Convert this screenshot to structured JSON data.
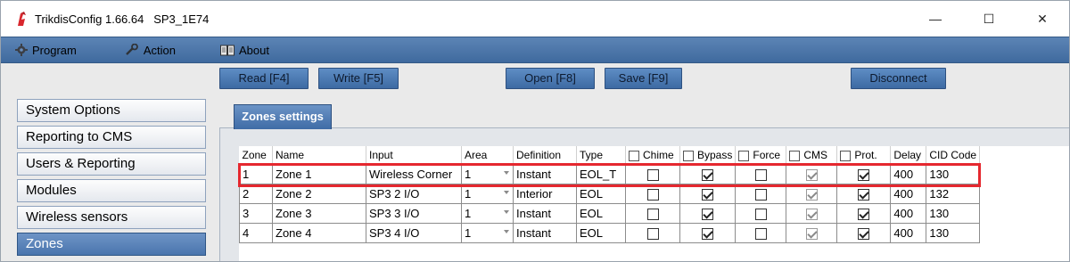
{
  "window": {
    "title": "TrikdisConfig 1.66.64   SP3_1E74",
    "minimize": "—",
    "maximize": "☐",
    "close": "✕"
  },
  "menu": {
    "program": "Program",
    "action": "Action",
    "about": "About"
  },
  "toolbar": {
    "read": "Read [F4]",
    "write": "Write [F5]",
    "open": "Open [F8]",
    "save": "Save [F9]",
    "disconnect": "Disconnect"
  },
  "sidebar": {
    "items": [
      {
        "label": "System Options"
      },
      {
        "label": "Reporting to CMS"
      },
      {
        "label": "Users & Reporting"
      },
      {
        "label": "Modules"
      },
      {
        "label": "Wireless sensors"
      },
      {
        "label": "Zones"
      }
    ],
    "active_index": 5
  },
  "tab": {
    "label": "Zones settings"
  },
  "table": {
    "headers": {
      "zone": "Zone",
      "name": "Name",
      "input": "Input",
      "area": "Area",
      "definition": "Definition",
      "type": "Type",
      "chime": "Chime",
      "bypass": "Bypass",
      "force": "Force",
      "cms": "CMS",
      "prot": "Prot.",
      "delay": "Delay",
      "cid": "CID Code"
    },
    "rows": [
      {
        "zone": "1",
        "name": "Zone 1",
        "input": "Wireless Corner",
        "area": "1",
        "definition": "Instant",
        "type": "EOL_T",
        "chime": false,
        "bypass": true,
        "force": false,
        "cms": true,
        "prot": true,
        "delay": "400",
        "cid": "130"
      },
      {
        "zone": "2",
        "name": "Zone 2",
        "input": "SP3 2 I/O",
        "area": "1",
        "definition": "Interior",
        "type": "EOL",
        "chime": false,
        "bypass": true,
        "force": false,
        "cms": true,
        "prot": true,
        "delay": "400",
        "cid": "132"
      },
      {
        "zone": "3",
        "name": "Zone 3",
        "input": "SP3 3 I/O",
        "area": "1",
        "definition": "Instant",
        "type": "EOL",
        "chime": false,
        "bypass": true,
        "force": false,
        "cms": true,
        "prot": true,
        "delay": "400",
        "cid": "130"
      },
      {
        "zone": "4",
        "name": "Zone 4",
        "input": "SP3 4 I/O",
        "area": "1",
        "definition": "Instant",
        "type": "EOL",
        "chime": false,
        "bypass": true,
        "force": false,
        "cms": true,
        "prot": true,
        "delay": "400",
        "cid": "130"
      }
    ]
  },
  "colors": {
    "menubar": "#4a76aa",
    "button": "#4f7cb5",
    "highlight": "#e5282f"
  }
}
